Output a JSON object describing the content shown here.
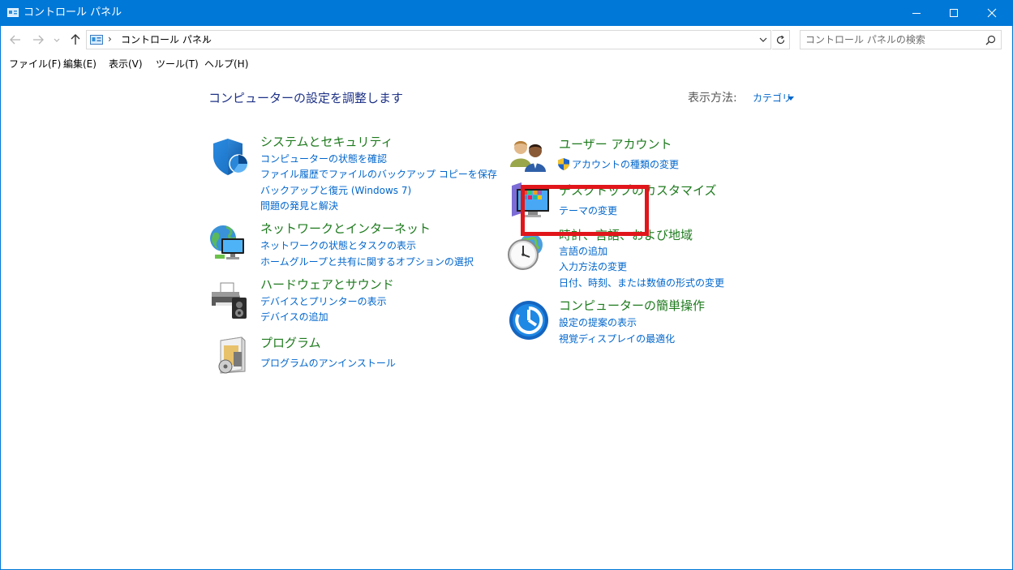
{
  "window": {
    "title": "コントロール パネル",
    "accent_color": "#0078d7"
  },
  "address": {
    "crumb": "コントロール パネル",
    "separator": "›"
  },
  "search": {
    "placeholder": "コントロール パネルの検索"
  },
  "menu": {
    "file": "ファイル(F)",
    "edit": "編集(E)",
    "view": "表示(V)",
    "tools": "ツール(T)",
    "help": "ヘルプ(H)"
  },
  "main": {
    "title": "コンピューターの設定を調整します",
    "view_by_label": "表示方法:",
    "view_by_value": "カテゴリ"
  },
  "categories": {
    "system": {
      "title": "システムとセキュリティ",
      "links": [
        "コンピューターの状態を確認",
        "ファイル履歴でファイルのバックアップ コピーを保存",
        "バックアップと復元 (Windows 7)",
        "問題の発見と解決"
      ]
    },
    "network": {
      "title": "ネットワークとインターネット",
      "links": [
        "ネットワークの状態とタスクの表示",
        "ホームグループと共有に関するオプションの選択"
      ]
    },
    "hardware": {
      "title": "ハードウェアとサウンド",
      "links": [
        "デバイスとプリンターの表示",
        "デバイスの追加"
      ]
    },
    "programs": {
      "title": "プログラム",
      "links": [
        "プログラムのアンインストール"
      ]
    },
    "users": {
      "title": "ユーザー アカウント",
      "links": [
        "アカウントの種類の変更"
      ]
    },
    "appearance": {
      "title": "デスクトップのカスタマイズ",
      "links": [
        "テーマの変更"
      ]
    },
    "clock": {
      "title": "時計、言語、および地域",
      "links": [
        "言語の追加",
        "入力方法の変更",
        "日付、時刻、または数値の形式の変更"
      ]
    },
    "ease": {
      "title": "コンピューターの簡単操作",
      "links": [
        "設定の提案の表示",
        "視覚ディスプレイの最適化"
      ]
    }
  },
  "annotation": {
    "highlight_color": "#e0161b"
  }
}
